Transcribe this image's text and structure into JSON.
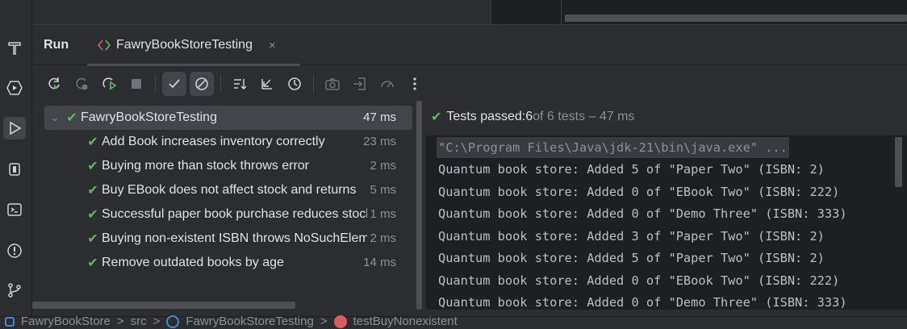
{
  "tool_window": {
    "title": "Run",
    "tab_label": "FawryBookStoreTesting",
    "tab_close": "×"
  },
  "toolbar": {
    "buttons": [
      "rerun",
      "rerun-failed",
      "toggle-auto-test",
      "stop",
      "show-passed",
      "show-ignored",
      "sort",
      "collapse",
      "history",
      "screenshot",
      "import",
      "coverage",
      "more"
    ]
  },
  "tree": {
    "root": {
      "name": "FawryBookStoreTesting",
      "duration": "47 ms"
    },
    "items": [
      {
        "name": "Add Book increases inventory correctly",
        "duration": "23 ms"
      },
      {
        "name": "Buying more than stock throws error",
        "duration": "2 ms"
      },
      {
        "name": "Buy EBook does not affect stock and returns",
        "duration": "5 ms"
      },
      {
        "name": "Successful paper book purchase reduces stock",
        "duration": "1 ms"
      },
      {
        "name": "Buying non-existent ISBN throws NoSuchElement",
        "duration": "2 ms"
      },
      {
        "name": "Remove outdated books by age",
        "duration": "14 ms"
      }
    ]
  },
  "status": {
    "prefix": "Tests passed: ",
    "passed": "6",
    "suffix": " of 6 tests – 47 ms"
  },
  "console": {
    "lines": [
      "\"C:\\Program Files\\Java\\jdk-21\\bin\\java.exe\" ...",
      "Quantum book store: Added 5 of \"Paper Two\" (ISBN: 2)",
      "Quantum book store: Added 0 of \"EBook Two\" (ISBN: 222)",
      "Quantum book store: Added 0 of \"Demo Three\" (ISBN: 333)",
      "Quantum book store: Added 3 of \"Paper Two\" (ISBN: 2)",
      "Quantum book store: Added 5 of \"Paper Two\" (ISBN: 2)",
      "Quantum book store: Added 0 of \"EBook Two\" (ISBN: 222)",
      "Quantum book store: Added 0 of \"Demo Three\" (ISBN: 333)"
    ]
  },
  "breadcrumb": {
    "project": "FawryBookStore",
    "folder": "src",
    "class": "FawryBookStoreTesting",
    "method": "testBuyNonexistent",
    "sep": ">"
  },
  "colors": {
    "pass_green": "#5fb865",
    "background": "#2b2d30",
    "console_bg": "#1e1f22"
  }
}
